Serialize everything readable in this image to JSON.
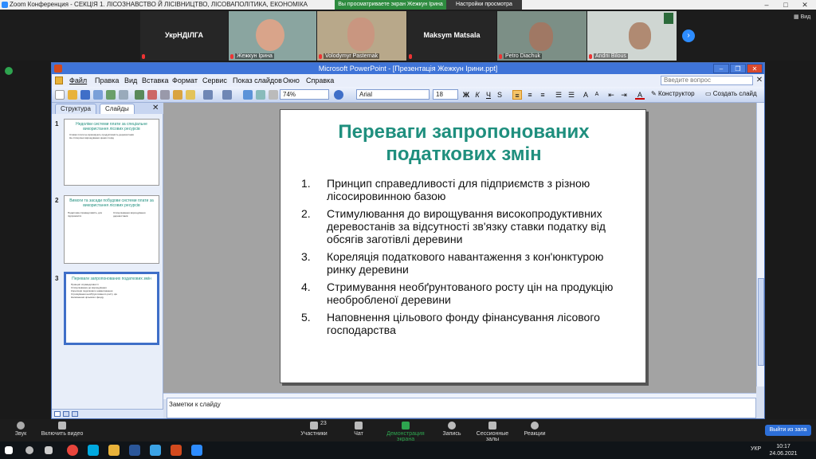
{
  "zoom": {
    "window_title": "Zoom Конференция - СЕКЦІЯ 1. ЛІСОЗНАВСТВО Й ЛІСІВНИЦТВО, ЛІСОВАПОЛІТИКА, ЕКОНОМІКА",
    "viewing_banner": "Вы просматриваете экран Жежкун Ірина",
    "settings_banner": "Настройки просмотра",
    "view_label": "Вид",
    "participants": [
      {
        "name": "УкрНДІЛГА"
      },
      {
        "name": "Жежкун Ірина"
      },
      {
        "name": "Volodymyr Pasternak"
      },
      {
        "name": "Maksym Matsala"
      },
      {
        "name": "Petro Diachuk"
      },
      {
        "name": "Andrii Bilous"
      }
    ],
    "bottom_bar": {
      "sound": "Звук",
      "video": "Включить видео",
      "participants": "Участники",
      "participants_count": "23",
      "chat": "Чат",
      "share": "Демонстрация экрана",
      "record": "Запись",
      "breakout": "Сессионные залы",
      "reactions": "Реакции",
      "leave": "Выйти из зала"
    }
  },
  "powerpoint": {
    "title": "Microsoft PowerPoint - [Презентація Жежкун Ірини.ppt]",
    "menu": [
      "Файл",
      "Правка",
      "Вид",
      "Вставка",
      "Формат",
      "Сервис",
      "Показ слайдов",
      "Окно",
      "Справка"
    ],
    "ask_placeholder": "Введите вопрос",
    "zoom_level": "74%",
    "font_name": "Arial",
    "font_size": "18",
    "designer_label": "Конструктор",
    "new_slide_label": "Создать слайд",
    "panel_tabs": [
      "Структура",
      "Слайды"
    ],
    "thumbnails": [
      {
        "number": "1",
        "title": "Недоліки системи плати за спеціальне використання лісових ресурсів",
        "lines": [
          "Ставки плати не враховують продуктивність деревостанів",
          "Не стимулює вирощування цінних порід"
        ]
      },
      {
        "number": "2",
        "title": "Вимоги та засади побудови системи плати за використання лісових ресурсів",
        "left": "Податкова справедливість для підприємств",
        "right": "Стимулювання вирощування деревостанів"
      },
      {
        "number": "3",
        "title": "Переваги запропонованих податкових змін",
        "lines": [
          "Принцип справедливості",
          "Стимулювання до вирощування",
          "Кореляція податкового навантаження",
          "Стримування необґрунтованого росту цін",
          "Наповнення цільового фонду"
        ]
      }
    ],
    "slide": {
      "title": "Переваги запропонованих податкових змін",
      "items": [
        {
          "num": "1.",
          "text": "Принцип справедливості для підприємств з різною лісосировинною базою"
        },
        {
          "num": "2.",
          "text": "Стимулювання до вирощування високопродуктивних деревостанів за відсутності зв'язку ставки податку від обсягів заготівлі деревини"
        },
        {
          "num": "3.",
          "text": "Кореляція податкового навантаження з кон'юнктурою ринку деревини"
        },
        {
          "num": "4.",
          "text": "Стримування необґрунтованого росту цін на продукцію необробленої деревини"
        },
        {
          "num": "5.",
          "text": "Наповнення цільового фонду фінансування лісового господарства"
        }
      ]
    },
    "notes_placeholder": "Заметки к слайду"
  },
  "taskbar": {
    "time": "10:17",
    "date": "24.06.2021",
    "lang": "УКР"
  }
}
